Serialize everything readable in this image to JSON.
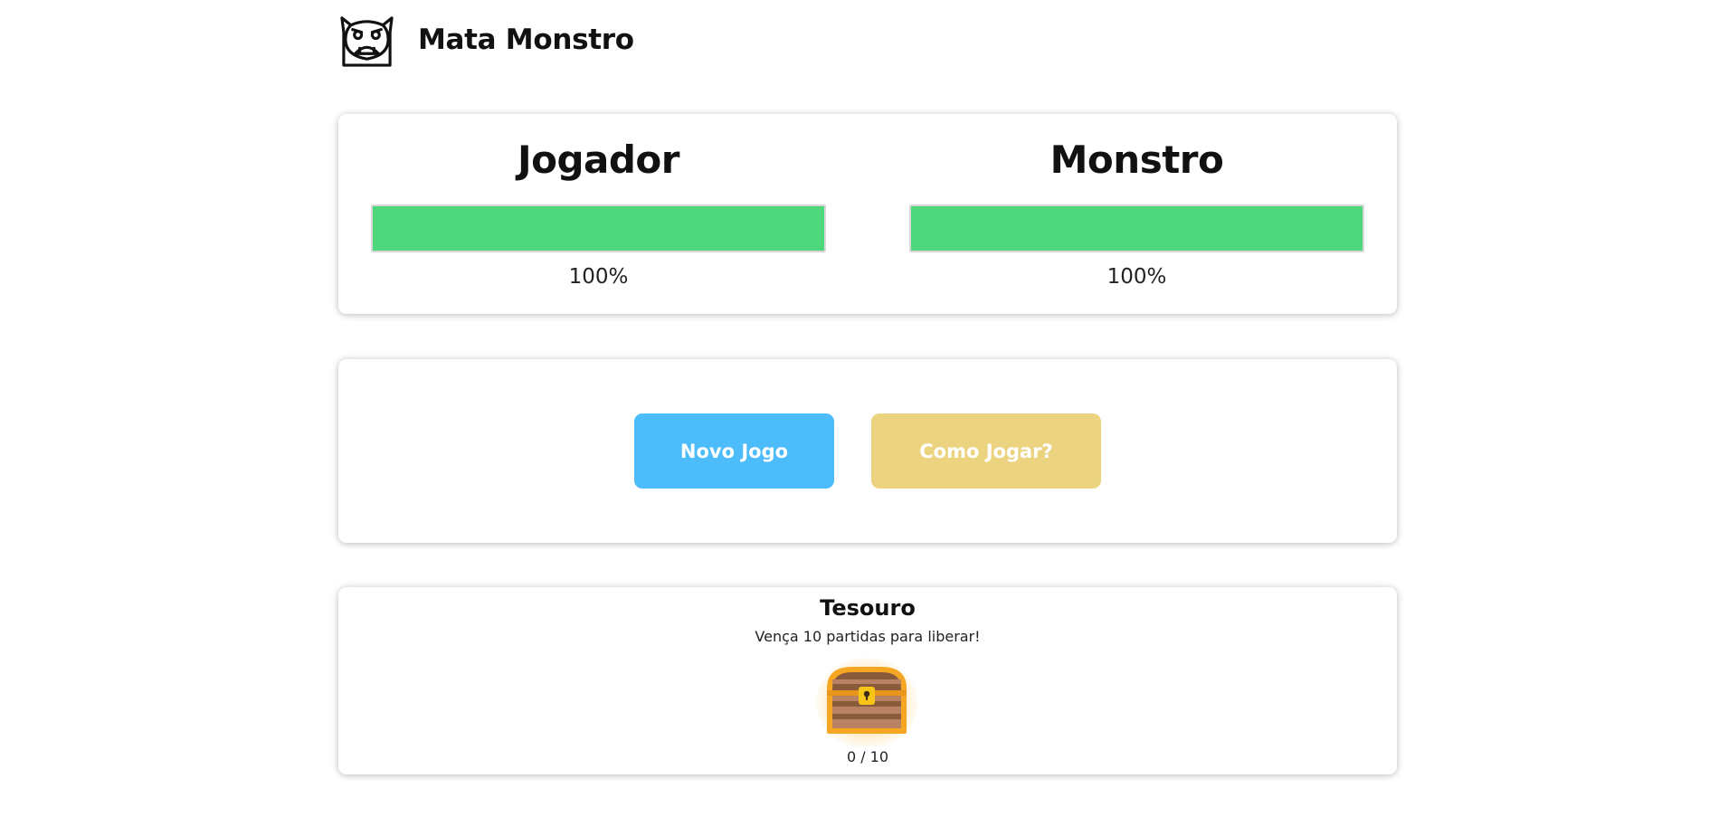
{
  "header": {
    "logo_icon": "monster-face-icon",
    "title": "Mata Monstro"
  },
  "health": {
    "player": {
      "name": "Jogador",
      "percent_label": "100%",
      "percent": 100
    },
    "monster": {
      "name": "Monstro",
      "percent_label": "100%",
      "percent": 100
    },
    "bar_color": "#4fd77e"
  },
  "actions": {
    "new_game": {
      "label": "Novo Jogo",
      "color": "#4cbcfa"
    },
    "how_to_play": {
      "label": "Como Jogar?",
      "color": "#ebd380"
    }
  },
  "treasure": {
    "title": "Tesouro",
    "subtitle": "Vença 10 partidas para liberar!",
    "icon": "treasure-chest-icon",
    "progress_label": "0 / 10",
    "wins": 0,
    "goal": 10
  }
}
